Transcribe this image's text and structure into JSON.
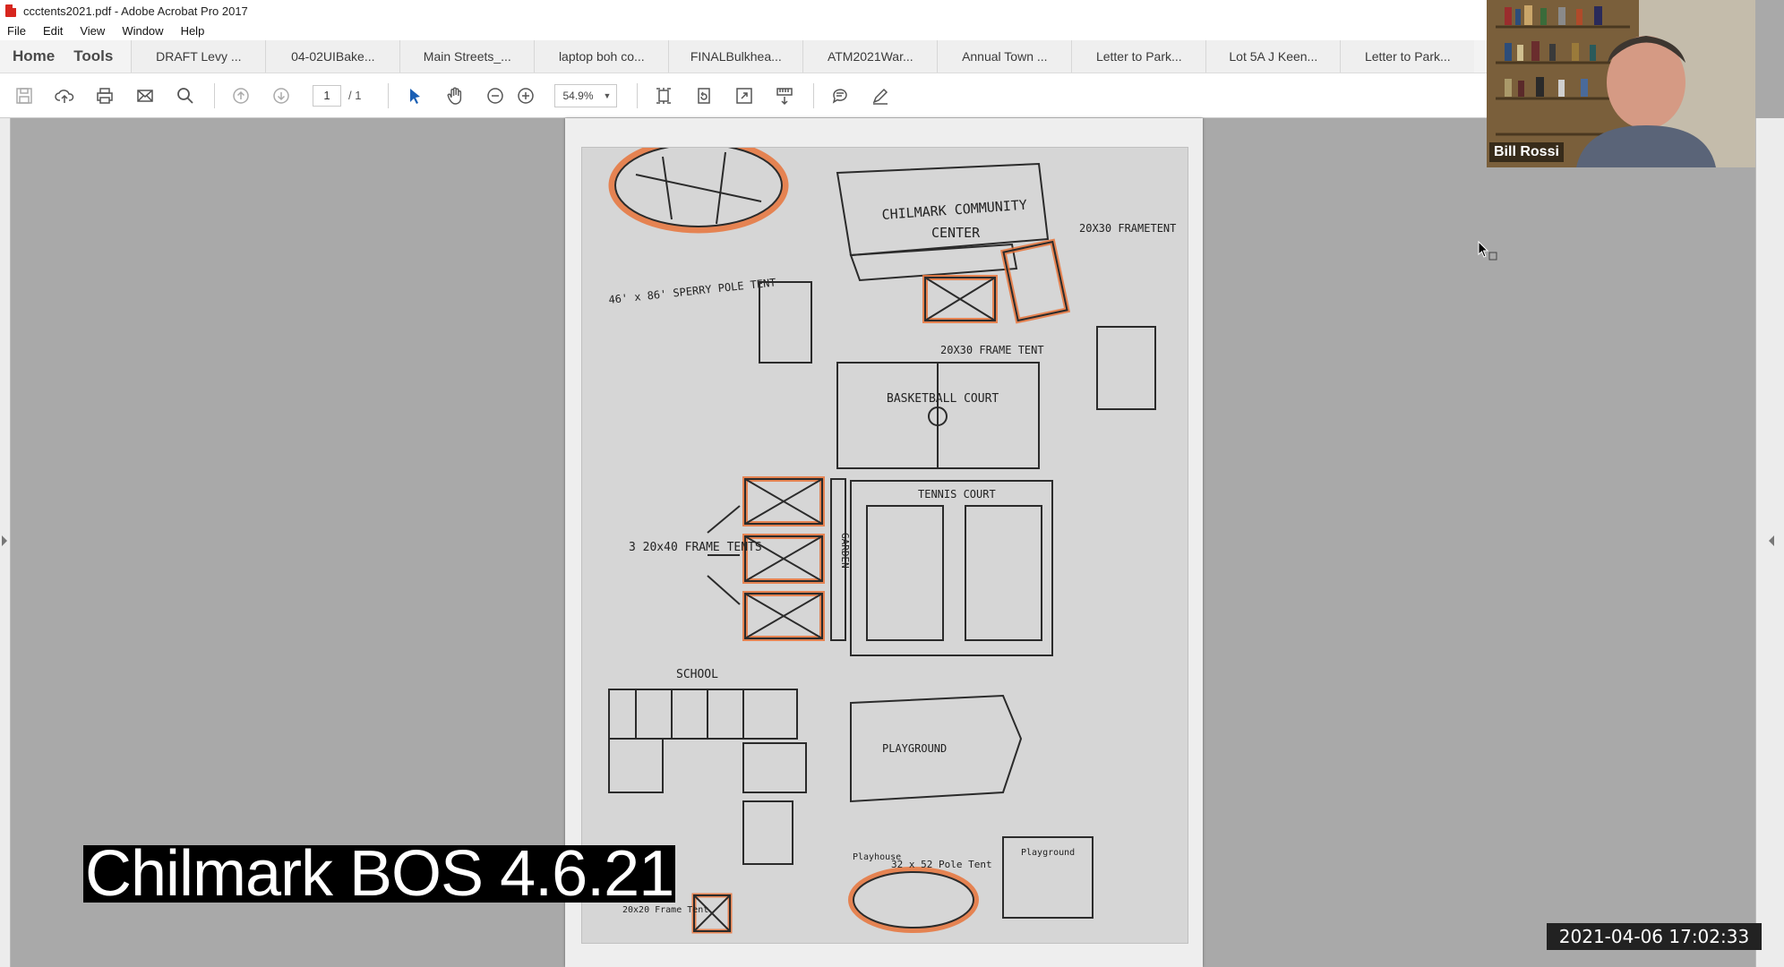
{
  "window": {
    "title": "ccctents2021.pdf - Adobe Acrobat Pro 2017"
  },
  "menu": [
    "File",
    "Edit",
    "View",
    "Window",
    "Help"
  ],
  "tabbar": {
    "home": "Home",
    "tools": "Tools",
    "tabs": [
      "DRAFT Levy ...",
      "04-02UIBake...",
      "Main Streets_...",
      "laptop boh co...",
      "FINALBulkhea...",
      "ATM2021War...",
      "Annual Town ...",
      "Letter to Park...",
      "Lot 5A J Keen...",
      "Letter to Park..."
    ]
  },
  "toolbar": {
    "page_current": "1",
    "page_total": "/ 1",
    "zoom": "54.9%"
  },
  "document": {
    "labels": {
      "community_center": "CHILMARK COMMUNITY CENTER",
      "frame_tent_top": "20X30 FRAMETENT",
      "sperry_tent": "46' x 86' SPERRY POLE TENT",
      "frame_tent_mid": "20X30 FRAME TENT",
      "basketball": "BASKETBALL COURT",
      "tennis": "TENNIS COURT",
      "three_tents": "3 20x40 FRAME TENTS",
      "garden": "GARDEN",
      "school": "SCHOOL",
      "playground": "PLAYGROUND",
      "playground2": "Playground",
      "pole_tent": "32 x 52 Pole Tent",
      "frame_tent_small": "20x20 Frame Tent",
      "playhouse": "Playhouse"
    }
  },
  "webcam": {
    "name": "Bill Rossi"
  },
  "caption": "Chilmark BOS 4.6.21",
  "timestamp": "2021-04-06  17:02:33",
  "colors": {
    "highlight": "#e8743b",
    "titlebar": "#ffffff",
    "doc_bg": "#a9a9a9"
  }
}
